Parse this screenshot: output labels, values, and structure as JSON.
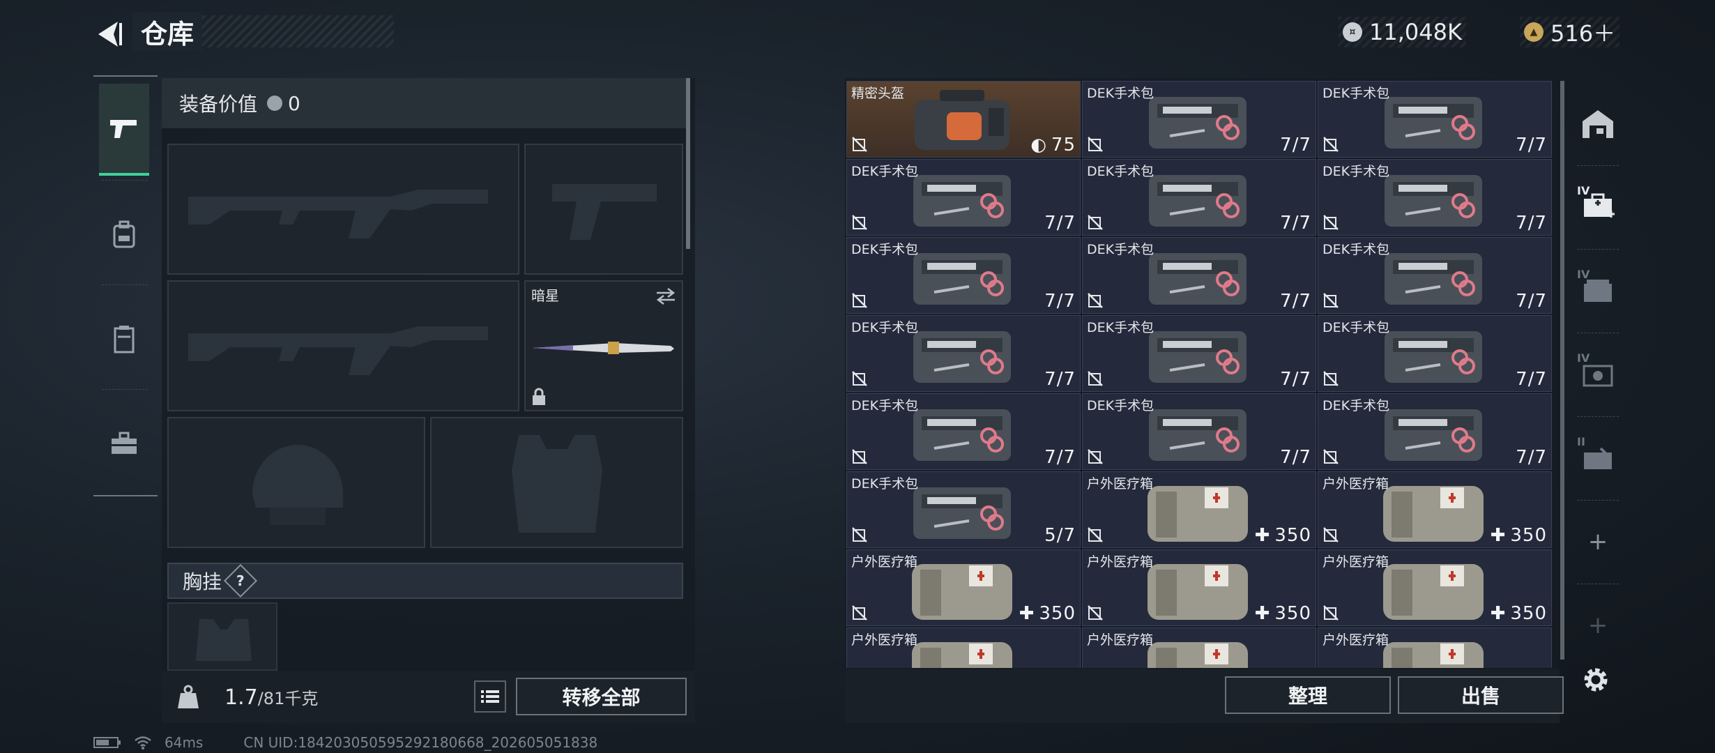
{
  "header": {
    "title": "仓库",
    "currency_coin": "11,048K",
    "currency_premium": "516＋"
  },
  "equipment": {
    "value_label": "装备价值",
    "value": "0",
    "melee_name": "暗星",
    "chest_label": "胸挂",
    "chest_help": "?",
    "weight_current": "1.7",
    "weight_max": "/81千克",
    "transfer_all": "转移全部"
  },
  "inventory": {
    "items": [
      {
        "name": "精密头盔",
        "count": "75",
        "kind": "helmet-bag"
      },
      {
        "name": "DEK手术包",
        "count": "7/7",
        "kind": "dek"
      },
      {
        "name": "DEK手术包",
        "count": "7/7",
        "kind": "dek"
      },
      {
        "name": "DEK手术包",
        "count": "7/7",
        "kind": "dek"
      },
      {
        "name": "DEK手术包",
        "count": "7/7",
        "kind": "dek"
      },
      {
        "name": "DEK手术包",
        "count": "7/7",
        "kind": "dek"
      },
      {
        "name": "DEK手术包",
        "count": "7/7",
        "kind": "dek"
      },
      {
        "name": "DEK手术包",
        "count": "7/7",
        "kind": "dek"
      },
      {
        "name": "DEK手术包",
        "count": "7/7",
        "kind": "dek"
      },
      {
        "name": "DEK手术包",
        "count": "7/7",
        "kind": "dek"
      },
      {
        "name": "DEK手术包",
        "count": "7/7",
        "kind": "dek"
      },
      {
        "name": "DEK手术包",
        "count": "7/7",
        "kind": "dek"
      },
      {
        "name": "DEK手术包",
        "count": "7/7",
        "kind": "dek"
      },
      {
        "name": "DEK手术包",
        "count": "7/7",
        "kind": "dek"
      },
      {
        "name": "DEK手术包",
        "count": "7/7",
        "kind": "dek"
      },
      {
        "name": "DEK手术包",
        "count": "5/7",
        "kind": "dek"
      },
      {
        "name": "户外医疗箱",
        "count": "350",
        "kind": "outdoor"
      },
      {
        "name": "户外医疗箱",
        "count": "350",
        "kind": "outdoor"
      },
      {
        "name": "户外医疗箱",
        "count": "350",
        "kind": "outdoor"
      },
      {
        "name": "户外医疗箱",
        "count": "350",
        "kind": "outdoor"
      },
      {
        "name": "户外医疗箱",
        "count": "350",
        "kind": "outdoor"
      },
      {
        "name": "户外医疗箱",
        "count": "",
        "kind": "outdoor"
      },
      {
        "name": "户外医疗箱",
        "count": "",
        "kind": "outdoor"
      },
      {
        "name": "户外医疗箱",
        "count": "",
        "kind": "outdoor"
      }
    ],
    "sort_label": "整理",
    "sell_label": "出售"
  },
  "rightnav": {
    "tier_labels": [
      "IV",
      "IV",
      "IV",
      "II"
    ],
    "add_symbol": "+"
  },
  "status": {
    "ping": "64ms",
    "uid": "CN UID:18420305059529218066​8_202605051838"
  },
  "colors": {
    "accent_green": "#3fd19a",
    "gold_cell": "#5a4230",
    "cell_bg": "#242a3c"
  }
}
